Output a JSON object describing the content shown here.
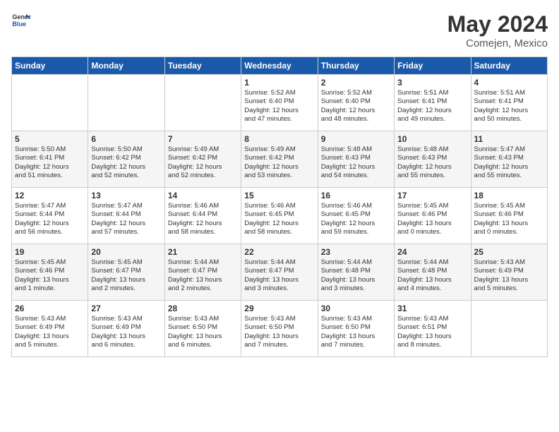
{
  "header": {
    "logo_general": "General",
    "logo_blue": "Blue",
    "month_year": "May 2024",
    "location": "Comejen, Mexico"
  },
  "weekdays": [
    "Sunday",
    "Monday",
    "Tuesday",
    "Wednesday",
    "Thursday",
    "Friday",
    "Saturday"
  ],
  "weeks": [
    [
      {
        "day": "",
        "content": ""
      },
      {
        "day": "",
        "content": ""
      },
      {
        "day": "",
        "content": ""
      },
      {
        "day": "1",
        "content": "Sunrise: 5:52 AM\nSunset: 6:40 PM\nDaylight: 12 hours\nand 47 minutes."
      },
      {
        "day": "2",
        "content": "Sunrise: 5:52 AM\nSunset: 6:40 PM\nDaylight: 12 hours\nand 48 minutes."
      },
      {
        "day": "3",
        "content": "Sunrise: 5:51 AM\nSunset: 6:41 PM\nDaylight: 12 hours\nand 49 minutes."
      },
      {
        "day": "4",
        "content": "Sunrise: 5:51 AM\nSunset: 6:41 PM\nDaylight: 12 hours\nand 50 minutes."
      }
    ],
    [
      {
        "day": "5",
        "content": "Sunrise: 5:50 AM\nSunset: 6:41 PM\nDaylight: 12 hours\nand 51 minutes."
      },
      {
        "day": "6",
        "content": "Sunrise: 5:50 AM\nSunset: 6:42 PM\nDaylight: 12 hours\nand 52 minutes."
      },
      {
        "day": "7",
        "content": "Sunrise: 5:49 AM\nSunset: 6:42 PM\nDaylight: 12 hours\nand 52 minutes."
      },
      {
        "day": "8",
        "content": "Sunrise: 5:49 AM\nSunset: 6:42 PM\nDaylight: 12 hours\nand 53 minutes."
      },
      {
        "day": "9",
        "content": "Sunrise: 5:48 AM\nSunset: 6:43 PM\nDaylight: 12 hours\nand 54 minutes."
      },
      {
        "day": "10",
        "content": "Sunrise: 5:48 AM\nSunset: 6:43 PM\nDaylight: 12 hours\nand 55 minutes."
      },
      {
        "day": "11",
        "content": "Sunrise: 5:47 AM\nSunset: 6:43 PM\nDaylight: 12 hours\nand 55 minutes."
      }
    ],
    [
      {
        "day": "12",
        "content": "Sunrise: 5:47 AM\nSunset: 6:44 PM\nDaylight: 12 hours\nand 56 minutes."
      },
      {
        "day": "13",
        "content": "Sunrise: 5:47 AM\nSunset: 6:44 PM\nDaylight: 12 hours\nand 57 minutes."
      },
      {
        "day": "14",
        "content": "Sunrise: 5:46 AM\nSunset: 6:44 PM\nDaylight: 12 hours\nand 58 minutes."
      },
      {
        "day": "15",
        "content": "Sunrise: 5:46 AM\nSunset: 6:45 PM\nDaylight: 12 hours\nand 58 minutes."
      },
      {
        "day": "16",
        "content": "Sunrise: 5:46 AM\nSunset: 6:45 PM\nDaylight: 12 hours\nand 59 minutes."
      },
      {
        "day": "17",
        "content": "Sunrise: 5:45 AM\nSunset: 6:46 PM\nDaylight: 13 hours\nand 0 minutes."
      },
      {
        "day": "18",
        "content": "Sunrise: 5:45 AM\nSunset: 6:46 PM\nDaylight: 13 hours\nand 0 minutes."
      }
    ],
    [
      {
        "day": "19",
        "content": "Sunrise: 5:45 AM\nSunset: 6:46 PM\nDaylight: 13 hours\nand 1 minute."
      },
      {
        "day": "20",
        "content": "Sunrise: 5:45 AM\nSunset: 6:47 PM\nDaylight: 13 hours\nand 2 minutes."
      },
      {
        "day": "21",
        "content": "Sunrise: 5:44 AM\nSunset: 6:47 PM\nDaylight: 13 hours\nand 2 minutes."
      },
      {
        "day": "22",
        "content": "Sunrise: 5:44 AM\nSunset: 6:47 PM\nDaylight: 13 hours\nand 3 minutes."
      },
      {
        "day": "23",
        "content": "Sunrise: 5:44 AM\nSunset: 6:48 PM\nDaylight: 13 hours\nand 3 minutes."
      },
      {
        "day": "24",
        "content": "Sunrise: 5:44 AM\nSunset: 6:48 PM\nDaylight: 13 hours\nand 4 minutes."
      },
      {
        "day": "25",
        "content": "Sunrise: 5:43 AM\nSunset: 6:49 PM\nDaylight: 13 hours\nand 5 minutes."
      }
    ],
    [
      {
        "day": "26",
        "content": "Sunrise: 5:43 AM\nSunset: 6:49 PM\nDaylight: 13 hours\nand 5 minutes."
      },
      {
        "day": "27",
        "content": "Sunrise: 5:43 AM\nSunset: 6:49 PM\nDaylight: 13 hours\nand 6 minutes."
      },
      {
        "day": "28",
        "content": "Sunrise: 5:43 AM\nSunset: 6:50 PM\nDaylight: 13 hours\nand 6 minutes."
      },
      {
        "day": "29",
        "content": "Sunrise: 5:43 AM\nSunset: 6:50 PM\nDaylight: 13 hours\nand 7 minutes."
      },
      {
        "day": "30",
        "content": "Sunrise: 5:43 AM\nSunset: 6:50 PM\nDaylight: 13 hours\nand 7 minutes."
      },
      {
        "day": "31",
        "content": "Sunrise: 5:43 AM\nSunset: 6:51 PM\nDaylight: 13 hours\nand 8 minutes."
      },
      {
        "day": "",
        "content": ""
      }
    ]
  ]
}
